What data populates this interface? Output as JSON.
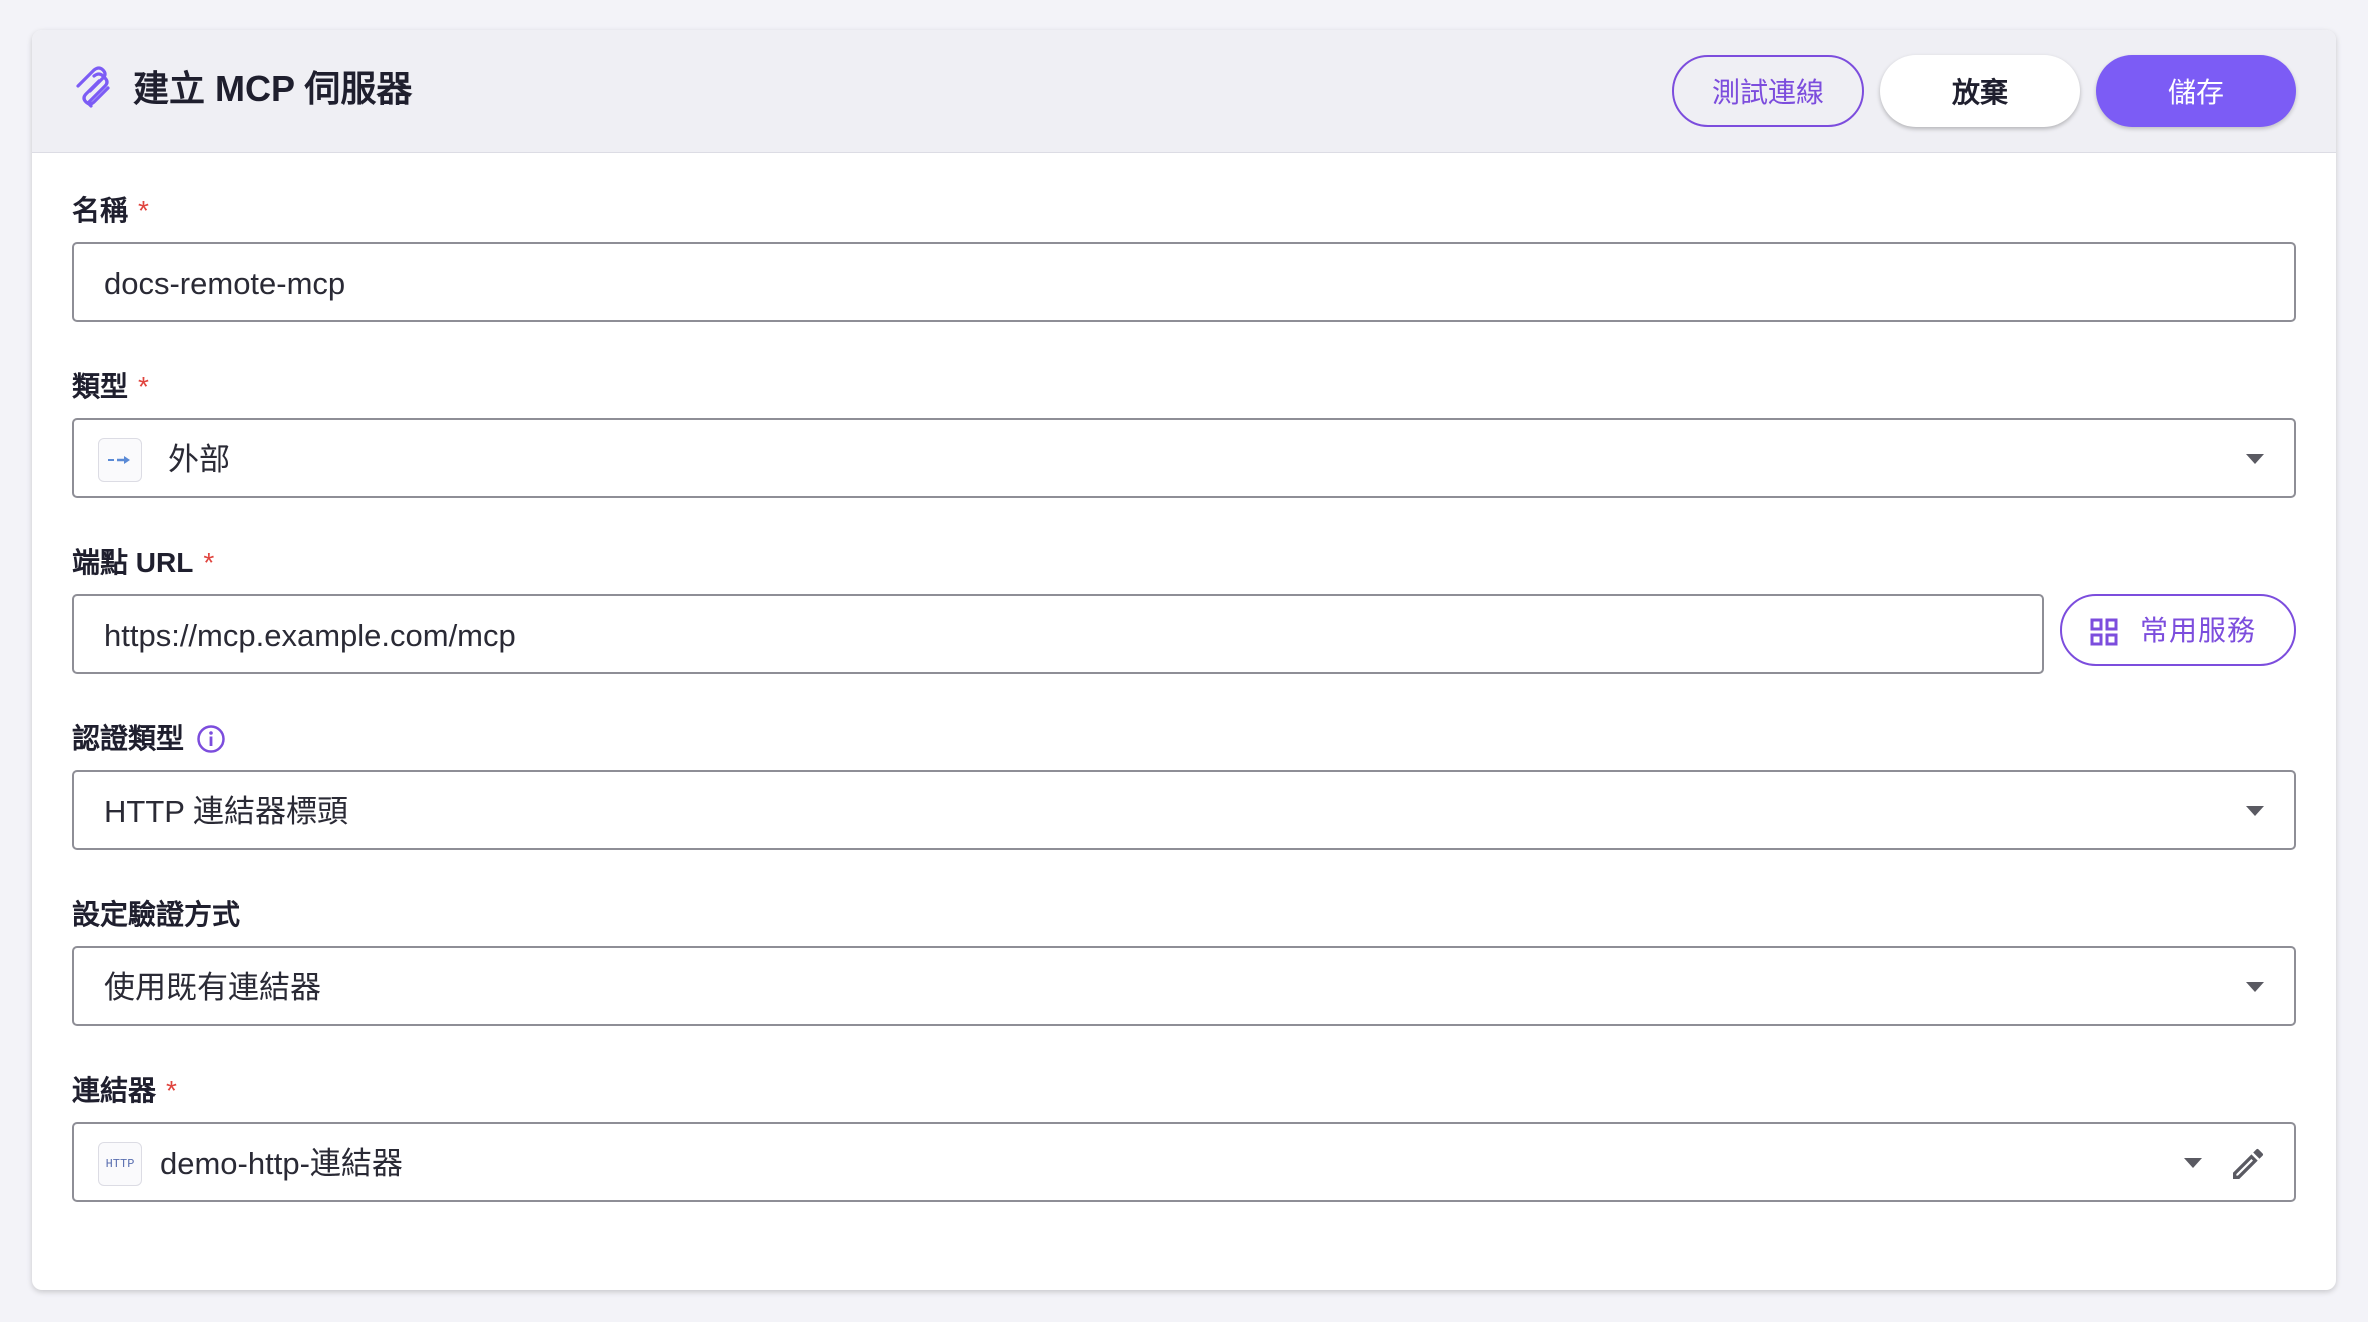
{
  "header": {
    "title": "建立 MCP 伺服器",
    "test_label": "測試連線",
    "discard_label": "放棄",
    "save_label": "儲存"
  },
  "form": {
    "name": {
      "label": "名稱",
      "required": "*",
      "value": "docs-remote-mcp"
    },
    "type": {
      "label": "類型",
      "required": "*",
      "value": "外部"
    },
    "endpoint": {
      "label": "端點 URL",
      "required": "*",
      "value": "https://mcp.example.com/mcp",
      "services_label": "常用服務"
    },
    "auth_type": {
      "label": "認證類型",
      "value": "HTTP 連結器標頭"
    },
    "auth_method": {
      "label": "設定驗證方式",
      "value": "使用既有連結器"
    },
    "connector": {
      "label": "連結器",
      "required": "*",
      "value": "demo-http-連結器",
      "icon_text": "HTTP"
    }
  },
  "colors": {
    "accent": "#7c5cf5",
    "required": "#e0443e",
    "border": "#8e8e96"
  }
}
